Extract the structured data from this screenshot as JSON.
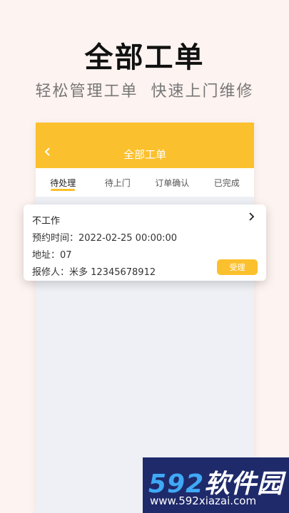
{
  "promo": {
    "title": "全部工单",
    "subtitle": "轻松管理工单  快速上门维修"
  },
  "app": {
    "nav_title": "全部工单",
    "back_icon": "chevron-left-icon",
    "tabs": [
      {
        "label": "待处理",
        "active": true
      },
      {
        "label": "待上门",
        "active": false
      },
      {
        "label": "订单确认",
        "active": false
      },
      {
        "label": "已完成",
        "active": false
      }
    ],
    "accent_color": "#fbc02d"
  },
  "order": {
    "title": "不工作",
    "appointment": "预约时间：2022-02-25 00:00:00",
    "address": "地址：07",
    "reporter": "报修人：米多 12345678912",
    "accept_label": "受理"
  },
  "watermark": {
    "logo_num": "592",
    "logo_cn": "软件园",
    "url": "www.592xiazai.com"
  }
}
